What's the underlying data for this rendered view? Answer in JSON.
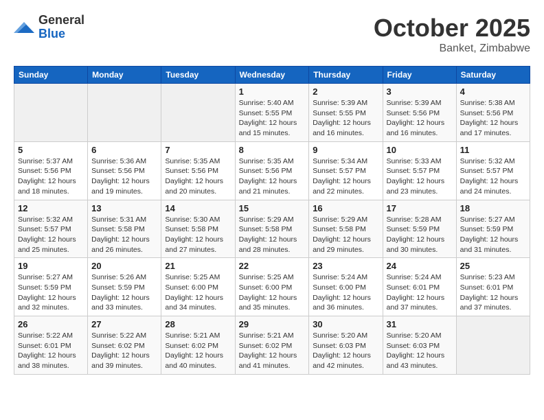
{
  "logo": {
    "general": "General",
    "blue": "Blue"
  },
  "title": {
    "month": "October 2025",
    "location": "Banket, Zimbabwe"
  },
  "weekdays": [
    "Sunday",
    "Monday",
    "Tuesday",
    "Wednesday",
    "Thursday",
    "Friday",
    "Saturday"
  ],
  "weeks": [
    [
      {
        "day": "",
        "info": ""
      },
      {
        "day": "",
        "info": ""
      },
      {
        "day": "",
        "info": ""
      },
      {
        "day": "1",
        "info": "Sunrise: 5:40 AM\nSunset: 5:55 PM\nDaylight: 12 hours\nand 15 minutes."
      },
      {
        "day": "2",
        "info": "Sunrise: 5:39 AM\nSunset: 5:55 PM\nDaylight: 12 hours\nand 16 minutes."
      },
      {
        "day": "3",
        "info": "Sunrise: 5:39 AM\nSunset: 5:56 PM\nDaylight: 12 hours\nand 16 minutes."
      },
      {
        "day": "4",
        "info": "Sunrise: 5:38 AM\nSunset: 5:56 PM\nDaylight: 12 hours\nand 17 minutes."
      }
    ],
    [
      {
        "day": "5",
        "info": "Sunrise: 5:37 AM\nSunset: 5:56 PM\nDaylight: 12 hours\nand 18 minutes."
      },
      {
        "day": "6",
        "info": "Sunrise: 5:36 AM\nSunset: 5:56 PM\nDaylight: 12 hours\nand 19 minutes."
      },
      {
        "day": "7",
        "info": "Sunrise: 5:35 AM\nSunset: 5:56 PM\nDaylight: 12 hours\nand 20 minutes."
      },
      {
        "day": "8",
        "info": "Sunrise: 5:35 AM\nSunset: 5:56 PM\nDaylight: 12 hours\nand 21 minutes."
      },
      {
        "day": "9",
        "info": "Sunrise: 5:34 AM\nSunset: 5:57 PM\nDaylight: 12 hours\nand 22 minutes."
      },
      {
        "day": "10",
        "info": "Sunrise: 5:33 AM\nSunset: 5:57 PM\nDaylight: 12 hours\nand 23 minutes."
      },
      {
        "day": "11",
        "info": "Sunrise: 5:32 AM\nSunset: 5:57 PM\nDaylight: 12 hours\nand 24 minutes."
      }
    ],
    [
      {
        "day": "12",
        "info": "Sunrise: 5:32 AM\nSunset: 5:57 PM\nDaylight: 12 hours\nand 25 minutes."
      },
      {
        "day": "13",
        "info": "Sunrise: 5:31 AM\nSunset: 5:58 PM\nDaylight: 12 hours\nand 26 minutes."
      },
      {
        "day": "14",
        "info": "Sunrise: 5:30 AM\nSunset: 5:58 PM\nDaylight: 12 hours\nand 27 minutes."
      },
      {
        "day": "15",
        "info": "Sunrise: 5:29 AM\nSunset: 5:58 PM\nDaylight: 12 hours\nand 28 minutes."
      },
      {
        "day": "16",
        "info": "Sunrise: 5:29 AM\nSunset: 5:58 PM\nDaylight: 12 hours\nand 29 minutes."
      },
      {
        "day": "17",
        "info": "Sunrise: 5:28 AM\nSunset: 5:59 PM\nDaylight: 12 hours\nand 30 minutes."
      },
      {
        "day": "18",
        "info": "Sunrise: 5:27 AM\nSunset: 5:59 PM\nDaylight: 12 hours\nand 31 minutes."
      }
    ],
    [
      {
        "day": "19",
        "info": "Sunrise: 5:27 AM\nSunset: 5:59 PM\nDaylight: 12 hours\nand 32 minutes."
      },
      {
        "day": "20",
        "info": "Sunrise: 5:26 AM\nSunset: 5:59 PM\nDaylight: 12 hours\nand 33 minutes."
      },
      {
        "day": "21",
        "info": "Sunrise: 5:25 AM\nSunset: 6:00 PM\nDaylight: 12 hours\nand 34 minutes."
      },
      {
        "day": "22",
        "info": "Sunrise: 5:25 AM\nSunset: 6:00 PM\nDaylight: 12 hours\nand 35 minutes."
      },
      {
        "day": "23",
        "info": "Sunrise: 5:24 AM\nSunset: 6:00 PM\nDaylight: 12 hours\nand 36 minutes."
      },
      {
        "day": "24",
        "info": "Sunrise: 5:24 AM\nSunset: 6:01 PM\nDaylight: 12 hours\nand 37 minutes."
      },
      {
        "day": "25",
        "info": "Sunrise: 5:23 AM\nSunset: 6:01 PM\nDaylight: 12 hours\nand 37 minutes."
      }
    ],
    [
      {
        "day": "26",
        "info": "Sunrise: 5:22 AM\nSunset: 6:01 PM\nDaylight: 12 hours\nand 38 minutes."
      },
      {
        "day": "27",
        "info": "Sunrise: 5:22 AM\nSunset: 6:02 PM\nDaylight: 12 hours\nand 39 minutes."
      },
      {
        "day": "28",
        "info": "Sunrise: 5:21 AM\nSunset: 6:02 PM\nDaylight: 12 hours\nand 40 minutes."
      },
      {
        "day": "29",
        "info": "Sunrise: 5:21 AM\nSunset: 6:02 PM\nDaylight: 12 hours\nand 41 minutes."
      },
      {
        "day": "30",
        "info": "Sunrise: 5:20 AM\nSunset: 6:03 PM\nDaylight: 12 hours\nand 42 minutes."
      },
      {
        "day": "31",
        "info": "Sunrise: 5:20 AM\nSunset: 6:03 PM\nDaylight: 12 hours\nand 43 minutes."
      },
      {
        "day": "",
        "info": ""
      }
    ]
  ]
}
